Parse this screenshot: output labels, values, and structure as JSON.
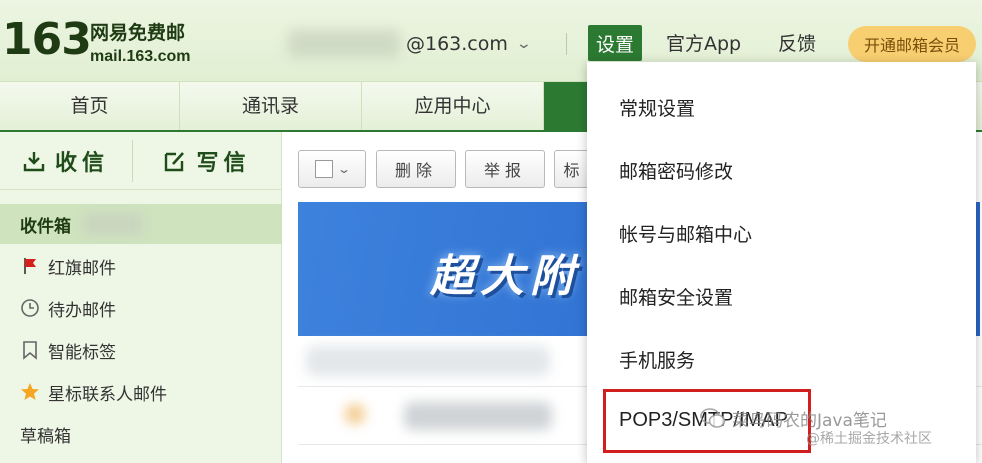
{
  "header": {
    "logo_number": "163",
    "logo_cn": "网易免费邮",
    "logo_url": "mail.163.com",
    "account_domain": "@163.com",
    "settings_label": "设置",
    "official_app_label": "官方App",
    "feedback_label": "反馈",
    "vip_label": "开通邮箱会员"
  },
  "tabs": [
    {
      "label": "首页"
    },
    {
      "label": "通讯录"
    },
    {
      "label": "应用中心"
    }
  ],
  "sidebar": {
    "receive_label": "收信",
    "write_label": "写信",
    "folders": [
      {
        "label": "收件箱"
      },
      {
        "label": "红旗邮件"
      },
      {
        "label": "待办邮件"
      },
      {
        "label": "智能标签"
      },
      {
        "label": "星标联系人邮件"
      },
      {
        "label": "草稿箱"
      }
    ]
  },
  "toolbar": {
    "delete_label": "删除",
    "report_label": "举报",
    "tag_label": "标"
  },
  "banner": {
    "text": "超大附"
  },
  "settings_menu": {
    "items": [
      {
        "label": "常规设置"
      },
      {
        "label": "邮箱密码修改"
      },
      {
        "label": "帐号与邮箱中心"
      },
      {
        "label": "邮箱安全设置"
      },
      {
        "label": "手机服务"
      },
      {
        "label": "POP3/SMTP/IMAP"
      }
    ]
  },
  "watermark": {
    "line1": "菜鸟码农的Java笔记",
    "line2": "@稀土掘金技术社区"
  },
  "colors": {
    "brand_green": "#2c7a32",
    "highlight_red": "#d11f1f",
    "vip_gold": "#f8cf70"
  }
}
